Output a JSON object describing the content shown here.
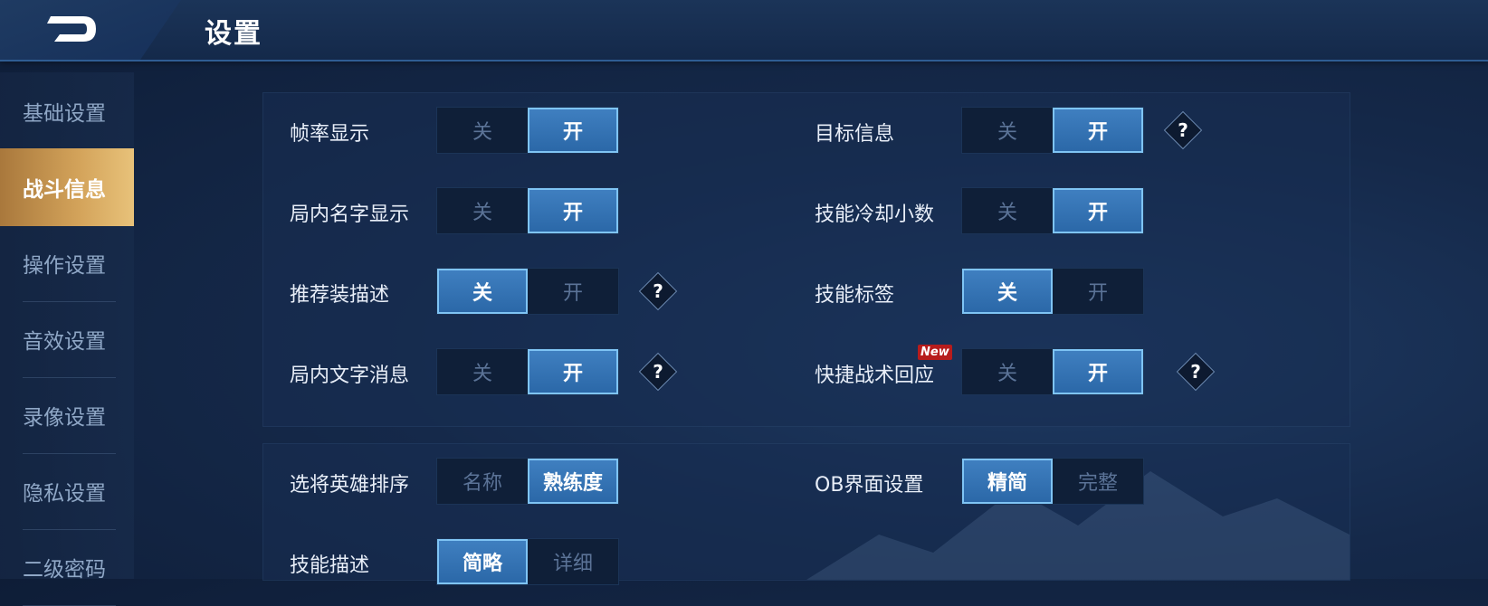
{
  "header": {
    "title": "设置"
  },
  "sidebar": {
    "items": [
      {
        "label": "基础设置",
        "active": false
      },
      {
        "label": "战斗信息",
        "active": true
      },
      {
        "label": "操作设置",
        "active": false
      },
      {
        "label": "音效设置",
        "active": false
      },
      {
        "label": "录像设置",
        "active": false
      },
      {
        "label": "隐私设置",
        "active": false
      },
      {
        "label": "二级密码",
        "active": false
      }
    ]
  },
  "settings": {
    "fps": {
      "label": "帧率显示",
      "options": [
        "关",
        "开"
      ],
      "selected": 1
    },
    "names": {
      "label": "局内名字显示",
      "options": [
        "关",
        "开"
      ],
      "selected": 1
    },
    "recommend": {
      "label": "推荐装描述",
      "options": [
        "关",
        "开"
      ],
      "selected": 0
    },
    "textmsg": {
      "label": "局内文字消息",
      "options": [
        "关",
        "开"
      ],
      "selected": 1
    },
    "target": {
      "label": "目标信息",
      "options": [
        "关",
        "开"
      ],
      "selected": 1
    },
    "cooldown": {
      "label": "技能冷却小数",
      "options": [
        "关",
        "开"
      ],
      "selected": 1
    },
    "skilltag": {
      "label": "技能标签",
      "options": [
        "关",
        "开"
      ],
      "selected": 0
    },
    "quickreply": {
      "label": "快捷战术回应",
      "options": [
        "关",
        "开"
      ],
      "selected": 1,
      "badge": "New"
    },
    "herosort": {
      "label": "选将英雄排序",
      "options": [
        "名称",
        "熟练度"
      ],
      "selected": 1
    },
    "obui": {
      "label": "OB界面设置",
      "options": [
        "精简",
        "完整"
      ],
      "selected": 0
    },
    "skilldesc": {
      "label": "技能描述",
      "options": [
        "简略",
        "详细"
      ],
      "selected": 0
    }
  },
  "help_symbol": "?",
  "colors": {
    "accent": "#2b68a8",
    "active_tab": "#d4a45b",
    "badge": "#b71c1c"
  }
}
